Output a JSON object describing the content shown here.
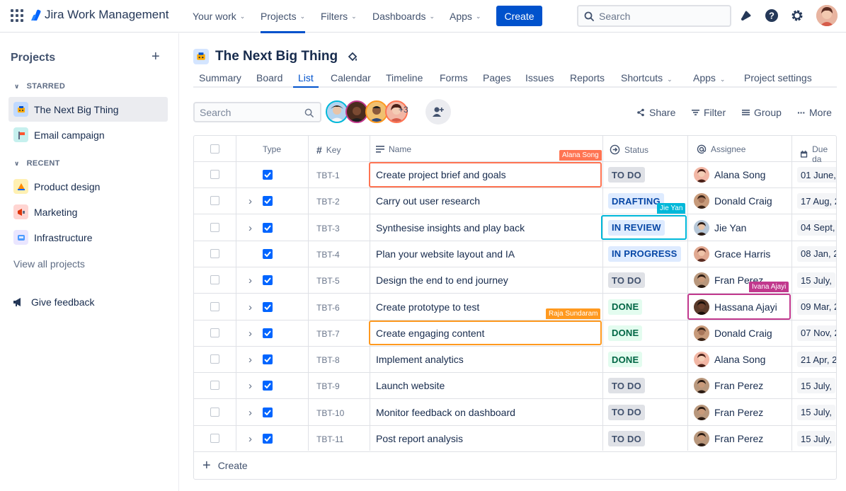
{
  "topbar": {
    "product": "Jira Work Management",
    "nav": [
      {
        "label": "Your work",
        "has_menu": true
      },
      {
        "label": "Projects",
        "has_menu": true,
        "active": true
      },
      {
        "label": "Filters",
        "has_menu": true
      },
      {
        "label": "Dashboards",
        "has_menu": true
      },
      {
        "label": "Apps",
        "has_menu": true
      }
    ],
    "create_label": "Create",
    "search_placeholder": "Search",
    "icons": [
      "notifications-icon",
      "help-icon",
      "settings-icon",
      "profile-avatar"
    ]
  },
  "sidebar": {
    "title": "Projects",
    "starred_heading": "STARRED",
    "starred": [
      {
        "label": "The Next Big Thing",
        "icon": "project-next-big-thing-icon",
        "selected": true
      }
    ],
    "email": {
      "label": "Email campaign",
      "icon": "project-email-icon"
    },
    "recent_heading": "RECENT",
    "recent": [
      {
        "label": "Product design",
        "icon": "project-product-design-icon"
      },
      {
        "label": "Marketing",
        "icon": "project-marketing-icon"
      },
      {
        "label": "Infrastructure",
        "icon": "project-infrastructure-icon"
      }
    ],
    "view_all": "View all projects",
    "feedback": "Give feedback"
  },
  "project": {
    "title": "The Next Big Thing",
    "tabs": [
      {
        "label": "Summary"
      },
      {
        "label": "Board"
      },
      {
        "label": "List",
        "active": true
      },
      {
        "label": "Calendar"
      },
      {
        "label": "Timeline"
      },
      {
        "label": "Forms"
      },
      {
        "label": "Pages"
      },
      {
        "label": "Issues"
      },
      {
        "label": "Reports"
      },
      {
        "label": "Shortcuts",
        "has_menu": true
      },
      {
        "label": "Apps",
        "has_menu": true
      },
      {
        "label": "Project settings"
      }
    ]
  },
  "toolbar": {
    "search_placeholder": "Search",
    "more_people": "+3",
    "share": "Share",
    "filter": "Filter",
    "group": "Group",
    "more": "More"
  },
  "table": {
    "columns": {
      "type": "Type",
      "key": "Key",
      "name": "Name",
      "status": "Status",
      "assignee": "Assignee",
      "due": "Due da"
    },
    "rows": [
      {
        "key": "TBT-1",
        "expandable": false,
        "name": "Create project brief and goals",
        "status": "TO DO",
        "status_style": "todo",
        "assignee": "Alana Song",
        "due": "01 June,"
      },
      {
        "key": "TBT-2",
        "expandable": true,
        "name": "Carry out user research",
        "status": "DRAFTING",
        "status_style": "blue",
        "assignee": "Donald Craig",
        "due": "17 Aug, 2"
      },
      {
        "key": "TBT-3",
        "expandable": true,
        "name": "Synthesise insights and play back",
        "status": "IN REVIEW",
        "status_style": "blue",
        "assignee": "Jie Yan",
        "due": "04 Sept,"
      },
      {
        "key": "TBT-4",
        "expandable": false,
        "name": "Plan your website layout and IA",
        "status": "IN PROGRESS",
        "status_style": "blue",
        "assignee": "Grace Harris",
        "due": "08 Jan, 2"
      },
      {
        "key": "TBT-5",
        "expandable": true,
        "name": "Design the end to end journey",
        "status": "TO DO",
        "status_style": "todo",
        "assignee": "Fran Perez",
        "due": "15 July,"
      },
      {
        "key": "TBT-6",
        "expandable": true,
        "name": "Create prototype to test",
        "status": "DONE",
        "status_style": "done",
        "assignee": "Hassana Ajayi",
        "due": "09 Mar, 2"
      },
      {
        "key": "TBT-7",
        "expandable": true,
        "name": "Create engaging content",
        "status": "DONE",
        "status_style": "done",
        "assignee": "Donald Craig",
        "due": "07 Nov, 2"
      },
      {
        "key": "TBT-8",
        "expandable": true,
        "name": "Implement analytics",
        "status": "DONE",
        "status_style": "done",
        "assignee": "Alana Song",
        "due": "21 Apr, 2"
      },
      {
        "key": "TBT-9",
        "expandable": true,
        "name": "Launch website",
        "status": "TO DO",
        "status_style": "todo",
        "assignee": "Fran Perez",
        "due": "15 July,"
      },
      {
        "key": "TBT-10",
        "expandable": true,
        "name": "Monitor feedback on dashboard",
        "status": "TO DO",
        "status_style": "todo",
        "assignee": "Fran Perez",
        "due": "15 July,"
      },
      {
        "key": "TBT-11",
        "expandable": true,
        "name": "Post report analysis",
        "status": "TO DO",
        "status_style": "todo",
        "assignee": "Fran Perez",
        "due": "15 July,"
      }
    ],
    "create_label": "Create"
  },
  "collaborators": [
    {
      "name": "Alana Song",
      "color": "#FF7452"
    },
    {
      "name": "Jie Yan",
      "color": "#00B8D9"
    },
    {
      "name": "Ivana Ajayi",
      "color": "#C1388D"
    },
    {
      "name": "Raja Sundaram",
      "color": "#FF991F"
    }
  ],
  "colors": {
    "brand": "#0052CC",
    "checkbox": "#0065FF"
  }
}
